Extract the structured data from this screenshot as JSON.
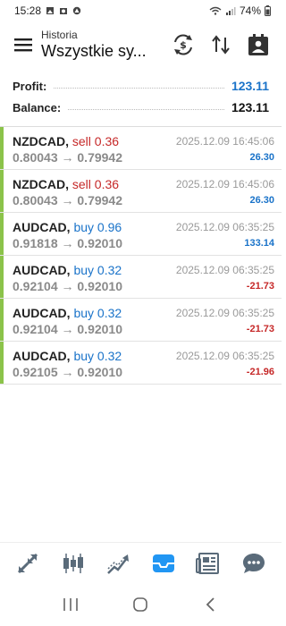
{
  "status": {
    "time": "15:28",
    "battery": "74%"
  },
  "header": {
    "subtitle": "Historia",
    "title": "Wszystkie sy..."
  },
  "summary": {
    "profit_label": "Profit:",
    "profit_value": "123.11",
    "balance_label": "Balance:",
    "balance_value": "123.11"
  },
  "trades": [
    {
      "symbol": "NZDCAD,",
      "side": "sell 0.36",
      "side_type": "sell",
      "open": "0.80043",
      "arrow": "→",
      "close": "0.79942",
      "time": "2025.12.09 16:45:06",
      "pl": "26.30",
      "pl_type": "pos"
    },
    {
      "symbol": "NZDCAD,",
      "side": "sell 0.36",
      "side_type": "sell",
      "open": "0.80043",
      "arrow": "→",
      "close": "0.79942",
      "time": "2025.12.09 16:45:06",
      "pl": "26.30",
      "pl_type": "pos"
    },
    {
      "symbol": "AUDCAD,",
      "side": "buy 0.96",
      "side_type": "buy",
      "open": "0.91818",
      "arrow": "→",
      "close": "0.92010",
      "time": "2025.12.09 06:35:25",
      "pl": "133.14",
      "pl_type": "pos"
    },
    {
      "symbol": "AUDCAD,",
      "side": "buy 0.32",
      "side_type": "buy",
      "open": "0.92104",
      "arrow": "→",
      "close": "0.92010",
      "time": "2025.12.09 06:35:25",
      "pl": "-21.73",
      "pl_type": "neg"
    },
    {
      "symbol": "AUDCAD,",
      "side": "buy 0.32",
      "side_type": "buy",
      "open": "0.92104",
      "arrow": "→",
      "close": "0.92010",
      "time": "2025.12.09 06:35:25",
      "pl": "-21.73",
      "pl_type": "neg"
    },
    {
      "symbol": "AUDCAD,",
      "side": "buy 0.32",
      "side_type": "buy",
      "open": "0.92105",
      "arrow": "→",
      "close": "0.92010",
      "time": "2025.12.09 06:35:25",
      "pl": "-21.96",
      "pl_type": "neg"
    }
  ],
  "nav": [
    "quotes-icon",
    "chart-icon",
    "trade-icon",
    "history-icon",
    "news-icon",
    "messages-icon"
  ],
  "colors": {
    "profit_value": "#1a73c9",
    "balance_value": "#111111",
    "sell": "#c62828",
    "buy": "#1a73c9",
    "pos": "#1a73c9",
    "neg": "#c62828",
    "bar": "#8bc34a",
    "nav_icon": "#5a6b7a",
    "nav_active": "#2196f3"
  }
}
